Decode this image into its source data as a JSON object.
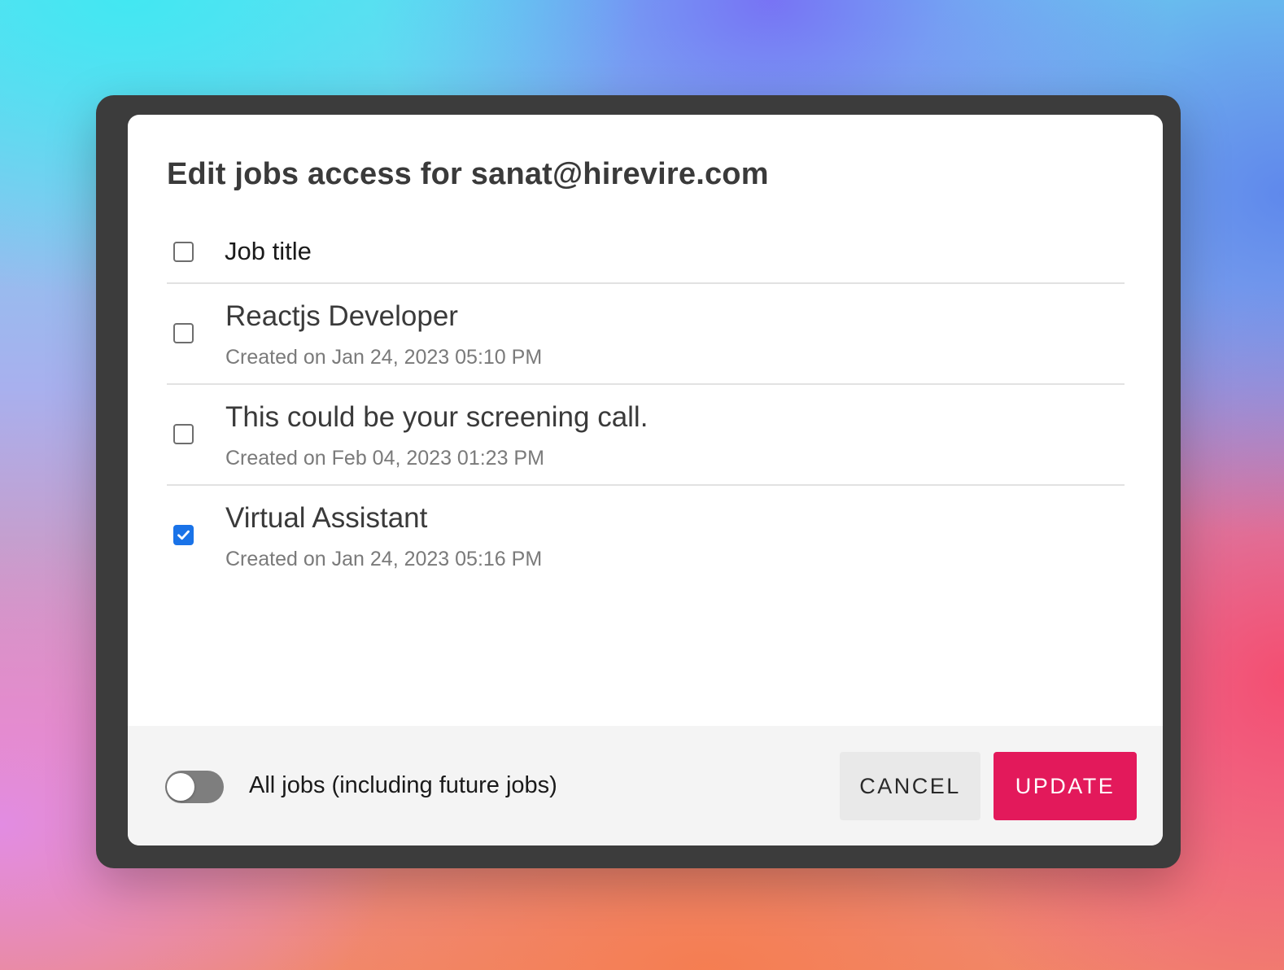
{
  "dialog": {
    "title": "Edit jobs access for sanat@hirevire.com"
  },
  "table": {
    "header_label": "Job title",
    "header_checked": false
  },
  "jobs": [
    {
      "title": "Reactjs Developer",
      "meta": "Created on Jan 24, 2023 05:10 PM",
      "checked": false
    },
    {
      "title": "This could be your screening call.",
      "meta": "Created on Feb 04, 2023 01:23 PM",
      "checked": false
    },
    {
      "title": "Virtual Assistant",
      "meta": "Created on Jan 24, 2023 05:16 PM",
      "checked": true
    }
  ],
  "footer": {
    "all_jobs_label": "All jobs (including future jobs)",
    "all_jobs_enabled": false,
    "cancel_label": "CANCEL",
    "update_label": "UPDATE"
  },
  "colors": {
    "accent": "#e3195b",
    "checkbox_checked": "#1a73e8",
    "frame": "#3c3c3c"
  }
}
